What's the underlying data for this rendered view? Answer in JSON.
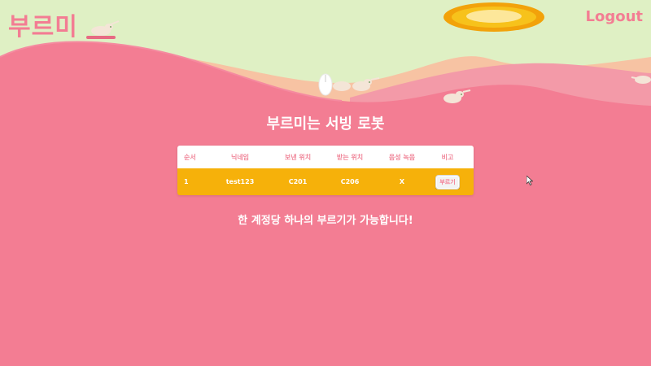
{
  "app": {
    "logo": "부르미",
    "logout_label": "Logout"
  },
  "colors": {
    "sky": "#dff0c4",
    "background": "#f37d93",
    "hill_back": "#f7c3a3",
    "hill_mid": "#f39aa8",
    "sun": "#f7b90f",
    "table_row": "#f6b10a"
  },
  "main": {
    "headline": "부르미는 서빙 로봇",
    "notice": "한 계정당 하나의 부르기가 가능합니다!"
  },
  "table": {
    "columns": [
      "순서",
      "닉네임",
      "보낸 위치",
      "받는 위치",
      "음성 녹음",
      "비고"
    ],
    "rows": [
      {
        "order": "1",
        "nickname": "test123",
        "from": "C201",
        "to": "C206",
        "voice": "X",
        "action_label": "부르기"
      }
    ]
  },
  "icons": [
    "sun-icon",
    "robot-icon",
    "rabbit-icon",
    "cursor-icon"
  ]
}
